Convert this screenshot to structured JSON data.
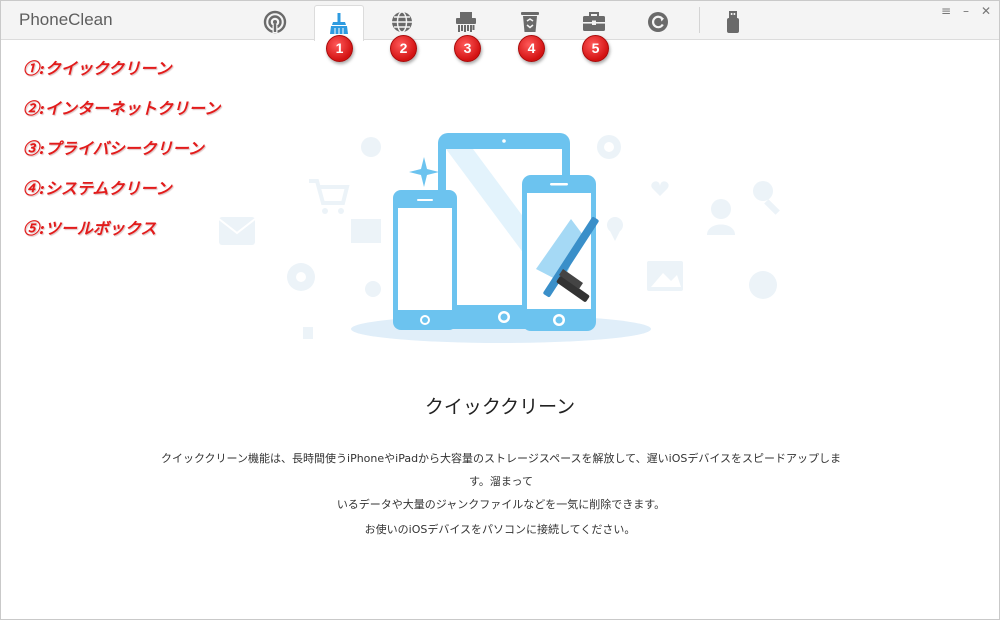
{
  "app": {
    "title": "PhoneClean"
  },
  "toolbar": {
    "tabs": [
      {
        "name": "tab-home",
        "icon": "podcast-icon"
      },
      {
        "name": "tab-quick-clean",
        "icon": "broom-icon",
        "active": true,
        "badge": "1"
      },
      {
        "name": "tab-internet-clean",
        "icon": "globe-icon",
        "badge": "2"
      },
      {
        "name": "tab-privacy-clean",
        "icon": "shredder-icon",
        "badge": "3"
      },
      {
        "name": "tab-system-clean",
        "icon": "recycle-bin-icon",
        "badge": "4"
      },
      {
        "name": "tab-toolbox",
        "icon": "toolbox-icon",
        "badge": "5"
      },
      {
        "name": "tab-restore",
        "icon": "restore-icon"
      },
      {
        "name": "tab-device",
        "icon": "usb-icon"
      }
    ]
  },
  "window_controls": {
    "menu": "≡",
    "minimize": "–",
    "close": "✕"
  },
  "legend": [
    "①:クイッククリーン",
    "②:インターネットクリーン",
    "③:プライバシークリーン",
    "④:システムクリーン",
    "⑤:ツールボックス"
  ],
  "main": {
    "title": "クイッククリーン",
    "description_line1": "クイッククリーン機能は、長時間使うiPhoneやiPadから大容量のストレージスペースを解放して、遅いiOSデバイスをスピードアップします。溜まって",
    "description_line2": "いるデータや大量のジャンクファイルなどを一気に削除できます。",
    "connect_prompt": "お使いのiOSデバイスをパソコンに接続してください。"
  },
  "colors": {
    "accent": "#2e9be0",
    "badge": "#d31212",
    "device": "#6cc3ef",
    "legend_text": "#e21b1b"
  }
}
